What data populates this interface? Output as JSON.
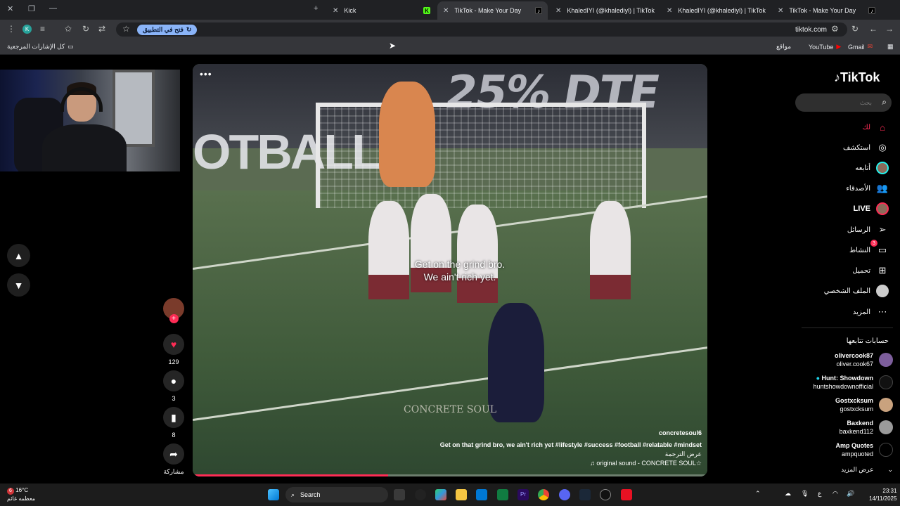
{
  "browser": {
    "tabs": [
      {
        "title": "Kick",
        "favicon": "kick-icon"
      },
      {
        "title": "TikTok - Make Your Day",
        "favicon": "tiktok-icon",
        "active": true
      },
      {
        "title": "KhaledIYI (@khalediyl) | TikTok",
        "favicon": "tiktok-icon"
      },
      {
        "title": "KhaledIYI (@khalediyl) | TikTok",
        "favicon": "tiktok-icon"
      },
      {
        "title": "TikTok - Make Your Day",
        "favicon": "tiktok-icon"
      }
    ],
    "profile_initial": "K",
    "open_in_app": "فتح في التطبيق",
    "url": "tiktok.com",
    "bookmarks": {
      "all_bookmarks": "كل الإشارات المرجعية",
      "items": [
        "Gmail",
        "YouTube",
        "مواقع"
      ]
    }
  },
  "video": {
    "caption_line1": "Get on the grind bro.",
    "caption_line2": "We ain't rich yet.",
    "watermark": "CONCRETE SOUL",
    "author": "concretesoul6",
    "description": "Get on that grind bro, we ain't rich yet #lifestyle #success #football #relatable #mindset",
    "translate": "عرض الترجمة",
    "sound": "♫ original sound - CONCRETE SOUL☆",
    "progress": 0.38
  },
  "actions": {
    "likes": "129",
    "comments": "3",
    "saves": "8",
    "share": "مشاركة"
  },
  "sidebar": {
    "logo": "TikTok",
    "search_placeholder": "بحث",
    "nav": [
      {
        "label": "لك",
        "icon": "home-icon"
      },
      {
        "label": "استكشف",
        "icon": "compass-icon"
      },
      {
        "label": "أتابعه",
        "icon": "following-avatar"
      },
      {
        "label": "الأصدقاء",
        "icon": "friends-icon"
      },
      {
        "label": "LIVE",
        "icon": "live-avatar"
      },
      {
        "label": "الرسائل",
        "icon": "send-icon"
      },
      {
        "label": "النشاط",
        "icon": "activity-icon",
        "badge": "3"
      },
      {
        "label": "تحميل",
        "icon": "plus-icon"
      },
      {
        "label": "الملف الشخصي",
        "icon": "profile-avatar"
      },
      {
        "label": "المزيد",
        "icon": "more-icon"
      }
    ],
    "following_title": "حسابات تتابعها",
    "accounts": [
      {
        "name": "olivercook87",
        "handle": "oliver.cook67"
      },
      {
        "name": "Hunt: Showdown",
        "handle": "huntshowdownofficial"
      },
      {
        "name": "Gostxcksum",
        "handle": "gostxcksum"
      },
      {
        "name": "Baxkend",
        "handle": "baxkend112"
      },
      {
        "name": "Amp Quotes",
        "handle": "ampquoted"
      }
    ],
    "see_more": "عرض المزيد"
  },
  "taskbar": {
    "weather_temp": "16°C",
    "weather_desc": "معظمه غائم",
    "weather_badge": "6",
    "search": "Search",
    "lang": "ع",
    "time": "23:31",
    "date": "14/11/2025"
  }
}
